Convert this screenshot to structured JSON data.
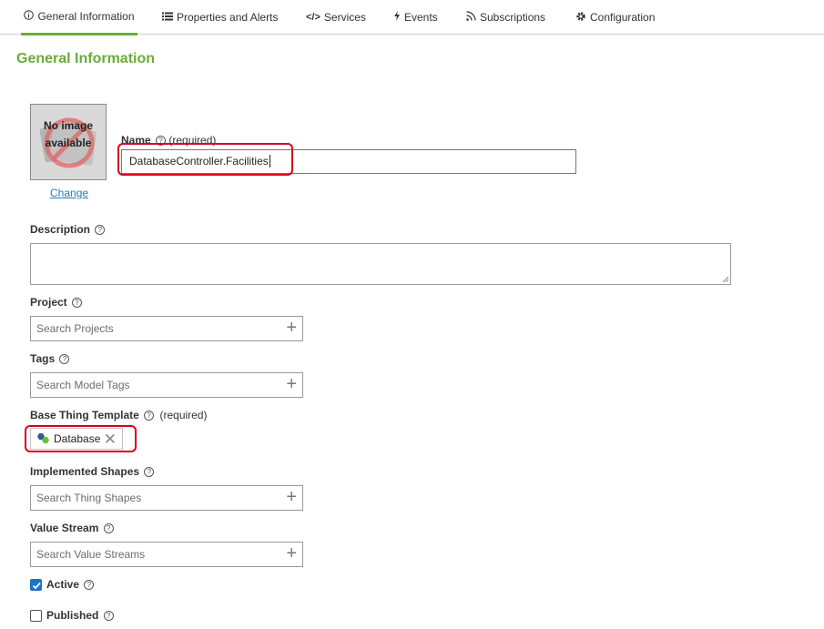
{
  "tabs": [
    {
      "label": "General Information",
      "icon": "info-icon",
      "active": true
    },
    {
      "label": "Properties and Alerts",
      "icon": "list-icon",
      "active": false
    },
    {
      "label": "Services",
      "icon": "code-icon",
      "active": false
    },
    {
      "label": "Events",
      "icon": "bolt-icon",
      "active": false
    },
    {
      "label": "Subscriptions",
      "icon": "rss-icon",
      "active": false
    },
    {
      "label": "Configuration",
      "icon": "gear-icon",
      "active": false
    }
  ],
  "page_title": "General Information",
  "image": {
    "placeholder_text": "No image available",
    "change_link": "Change"
  },
  "name": {
    "label": "Name",
    "required_text": "(required)",
    "value": "DatabaseController.Facilities"
  },
  "description": {
    "label": "Description",
    "value": ""
  },
  "project": {
    "label": "Project",
    "placeholder": "Search Projects"
  },
  "tags": {
    "label": "Tags",
    "placeholder": "Search Model Tags"
  },
  "base_thing_template": {
    "label": "Base Thing Template",
    "required_text": "(required)",
    "value": "Database"
  },
  "implemented_shapes": {
    "label": "Implemented Shapes",
    "placeholder": "Search Thing Shapes"
  },
  "value_stream": {
    "label": "Value Stream",
    "placeholder": "Search Value Streams"
  },
  "active": {
    "label": "Active",
    "checked": true
  },
  "published": {
    "label": "Published",
    "checked": false
  },
  "colors": {
    "accent": "#6aab3d",
    "highlight": "#d9001b",
    "checkbox": "#1a73c9",
    "link": "#2a7ab0"
  }
}
